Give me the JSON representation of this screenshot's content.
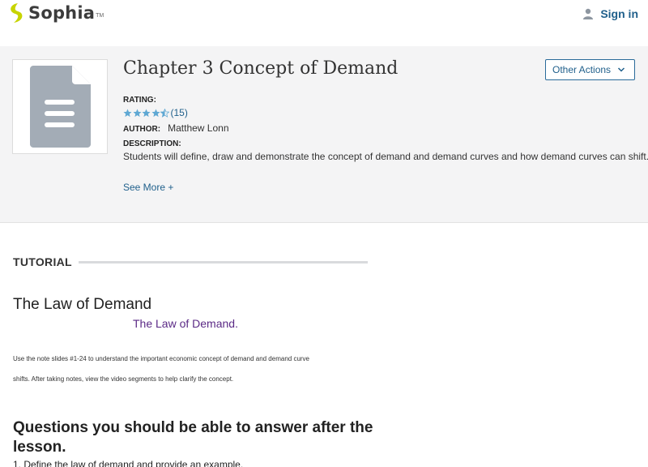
{
  "header": {
    "brand": "Sophia",
    "brand_mark": "TM",
    "sign_in_label": "Sign in"
  },
  "resource": {
    "title": "Chapter 3 Concept of Demand",
    "other_actions_label": "Other Actions",
    "rating_label": "RATING:",
    "rating_stars": 4.5,
    "rating_count": "(15)",
    "author_label": "AUTHOR:",
    "author_name": "Matthew Lonn",
    "description_label": "DESCRIPTION:",
    "description_text": "Students will define, draw and demonstrate the concept of demand and demand curves and how demand curves can shift.",
    "see_more_label": "See More +"
  },
  "content": {
    "section_label": "TUTORIAL",
    "heading": "The Law of Demand",
    "subheading": "The Law of Demand.",
    "paragraph_line1": "Use the note slides #1-24 to understand the important economic concept of demand and demand curve",
    "paragraph_line2": "shifts. After taking notes, view the video segments to help clarify the concept.",
    "questions_heading": "Questions you should be able to answer after the lesson.",
    "list_item_1": "1. Define the law of demand and provide an example."
  },
  "colors": {
    "accent": "#1f5f8b",
    "logo_yellow": "#c7d400",
    "star": "#5fa8d3",
    "subheading": "#5b2a86"
  },
  "icons": {
    "logo": "sophia-leaf-icon",
    "person": "person-icon",
    "chevron": "chevron-down-icon",
    "document": "document-icon",
    "star": "star-icon"
  }
}
